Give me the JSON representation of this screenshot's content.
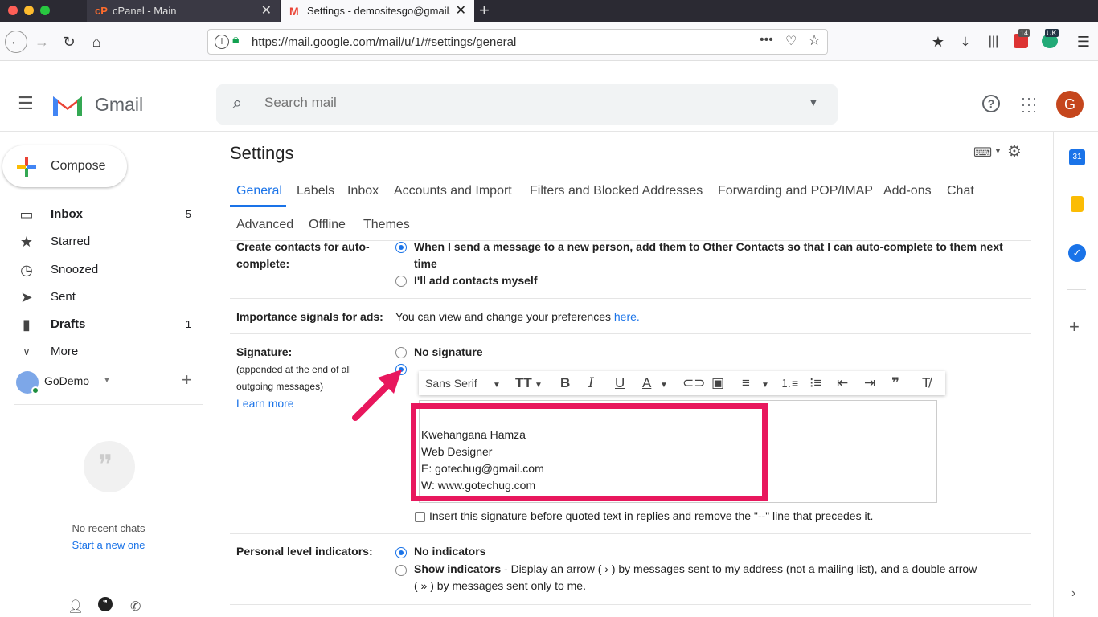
{
  "browser": {
    "tabs": [
      {
        "title": "cPanel - Main",
        "icon": "cpanel-icon"
      },
      {
        "title": "Settings - demositesgo@gmail.c",
        "icon": "gmail-icon"
      }
    ],
    "url": "https://mail.google.com/mail/u/1/#settings/general",
    "badges": {
      "notifications": "14",
      "locale": "UK"
    }
  },
  "header": {
    "app_name": "Gmail",
    "search_placeholder": "Search mail",
    "avatar_letter": "G"
  },
  "sidebar": {
    "compose": "Compose",
    "items": [
      {
        "label": "Inbox",
        "count": "5",
        "icon": "inbox-icon"
      },
      {
        "label": "Starred",
        "count": "",
        "icon": "star-icon"
      },
      {
        "label": "Snoozed",
        "count": "",
        "icon": "clock-icon"
      },
      {
        "label": "Sent",
        "count": "",
        "icon": "send-icon"
      },
      {
        "label": "Drafts",
        "count": "1",
        "icon": "draft-icon"
      },
      {
        "label": "More",
        "count": "",
        "icon": "chevron-down-icon"
      }
    ],
    "account": "GoDemo",
    "no_chats": "No recent chats",
    "start_chat": "Start a new one"
  },
  "settings": {
    "title": "Settings",
    "tabs_row1": [
      "General",
      "Labels",
      "Inbox",
      "Accounts and Import",
      "Filters and Blocked Addresses",
      "Forwarding and POP/IMAP",
      "Add-ons",
      "Chat"
    ],
    "tabs_row2": [
      "Advanced",
      "Offline",
      "Themes"
    ],
    "contacts": {
      "label_line1": "Create contacts for auto-",
      "label_line2": "complete:",
      "option1_line1": "When I send a message to a new person, add them to Other Contacts so that I can auto-complete to them next",
      "option1_line2": "time",
      "option2": "I'll add contacts myself"
    },
    "importance": {
      "label": "Importance signals for ads:",
      "text": "You can view and change your preferences",
      "link": "here."
    },
    "signature": {
      "label": "Signature:",
      "sub1": "(appended at the end of all",
      "sub2": "outgoing messages)",
      "learn_more": "Learn more",
      "no_signature": "No signature",
      "font": "Sans Serif",
      "lines": [
        "Kwehangana Hamza",
        "Web Designer",
        "E: gotechug@gmail.com",
        "W: www.gotechug.com"
      ],
      "insert_option": "Insert this signature before quoted text in replies and remove the \"--\" line that precedes it."
    },
    "personal": {
      "label": "Personal level indicators:",
      "no_indicators": "No indicators",
      "show_indicators": "Show indicators",
      "show_desc_line1": " - Display an arrow ( › ) by messages sent to my address (not a mailing list), and a double arrow",
      "show_desc_line2": "( » ) by messages sent only to me."
    }
  },
  "colors": {
    "accent": "#1a73e8",
    "highlight": "#e8175d",
    "avatar": "#c5461d"
  }
}
